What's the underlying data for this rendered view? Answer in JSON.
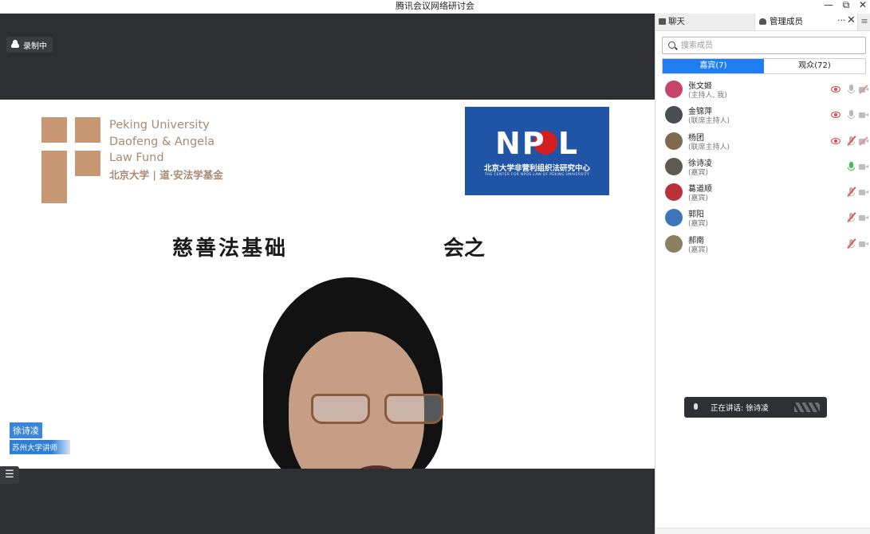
{
  "window": {
    "title": "腾讯会议网络研讨会",
    "minimize": "—",
    "restore": "⧉",
    "close": "✕"
  },
  "recording": {
    "label": "录制中"
  },
  "slide": {
    "logo_left_en": [
      "Peking University",
      "Daofeng & Angela",
      "Law Fund"
    ],
    "logo_left_cn": "北京大学 | 道·安法学基金",
    "logo_right_brand": "NP L",
    "logo_right_cn": "北京大学非营利组织法研究中心",
    "logo_right_en": "THE CENTER FOR NPOS LAW OF PEKING UNIVERSITY",
    "title_left": "慈善法基础",
    "title_right": "会之"
  },
  "speaker_tag": {
    "name": "徐诗凌",
    "role": "苏州大学讲师"
  },
  "list_button": "☰",
  "panel": {
    "tabs": {
      "chat": "聊天",
      "members": "管理成员"
    },
    "more": "···",
    "close": "✕",
    "menu": "≡",
    "search_placeholder": "搜索成员",
    "segments": {
      "guests": "嘉宾(7)",
      "audience": "观众(72)"
    },
    "members": [
      {
        "name": "张文姬",
        "role": "(主持人, 我)",
        "eye": true,
        "mic": "normal",
        "cam": "off",
        "avatar_color": "#c7456a"
      },
      {
        "name": "金锦萍",
        "role": "(联席主持人)",
        "eye": true,
        "mic": "normal",
        "cam": "normal",
        "avatar_color": "#4a4e52"
      },
      {
        "name": "杨团",
        "role": "(联席主持人)",
        "eye": true,
        "mic": "muted",
        "cam": "off",
        "avatar_color": "#7e6a4f"
      },
      {
        "name": "徐诗凌",
        "role": "(嘉宾)",
        "eye": false,
        "mic": "live",
        "cam": "normal",
        "avatar_color": "#5d5a50"
      },
      {
        "name": "葛道顺",
        "role": "(嘉宾)",
        "eye": false,
        "mic": "muted",
        "cam": "normal",
        "avatar_color": "#b8313b"
      },
      {
        "name": "郭阳",
        "role": "(嘉宾)",
        "eye": false,
        "mic": "muted",
        "cam": "normal",
        "avatar_color": "#3d76b8"
      },
      {
        "name": "郝南",
        "role": "(嘉宾)",
        "eye": false,
        "mic": "muted",
        "cam": "normal",
        "avatar_color": "#8a8060"
      }
    ]
  },
  "speaking": {
    "label": "正在讲话: 徐诗凌"
  }
}
